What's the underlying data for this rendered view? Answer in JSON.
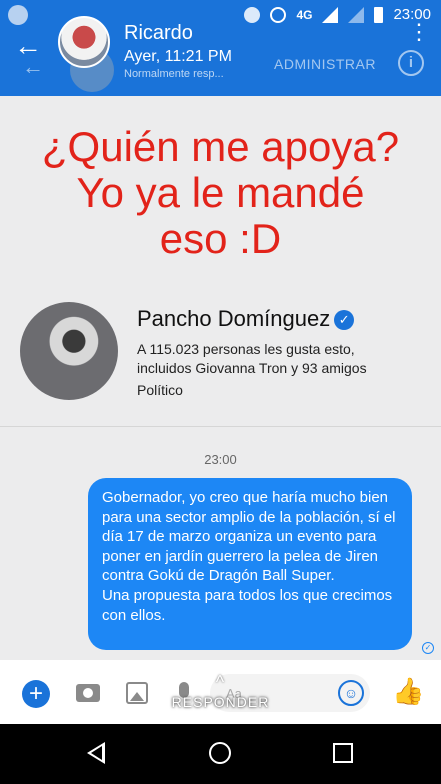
{
  "status_bar": {
    "network": "4G",
    "time": "23:00"
  },
  "header": {
    "contact_name": "Ricardo",
    "contact_time": "Ayer, 11:21 PM",
    "contact_status": "Normalmente resp...",
    "admin_label": "ADMINISTRAR"
  },
  "meme_text": [
    "¿Quién me apoya?",
    "Yo ya le mandé",
    "eso :D"
  ],
  "page_card": {
    "name": "Pancho Domínguez",
    "likes_line1": "A 115.023 personas les gusta esto,",
    "likes_line2": "incluidos Giovanna Tron y 93 amigos",
    "category": "Político"
  },
  "conversation": {
    "timestamp": "23:00",
    "message": "Gobernador, yo creo que haría mucho bien para una sector amplio de la población, sí el día  17 de marzo organiza un evento para poner en jardín guerrero la pelea de Jiren contra Gokú de Dragón Ball Super.\nUna propuesta para todos los que crecimos con ellos."
  },
  "composer": {
    "placeholder": "Aa",
    "reply_label": "RESPONDER"
  },
  "colors": {
    "brand": "#1a73d9",
    "bubble": "#1d87f5",
    "meme_red": "#e2231a"
  }
}
